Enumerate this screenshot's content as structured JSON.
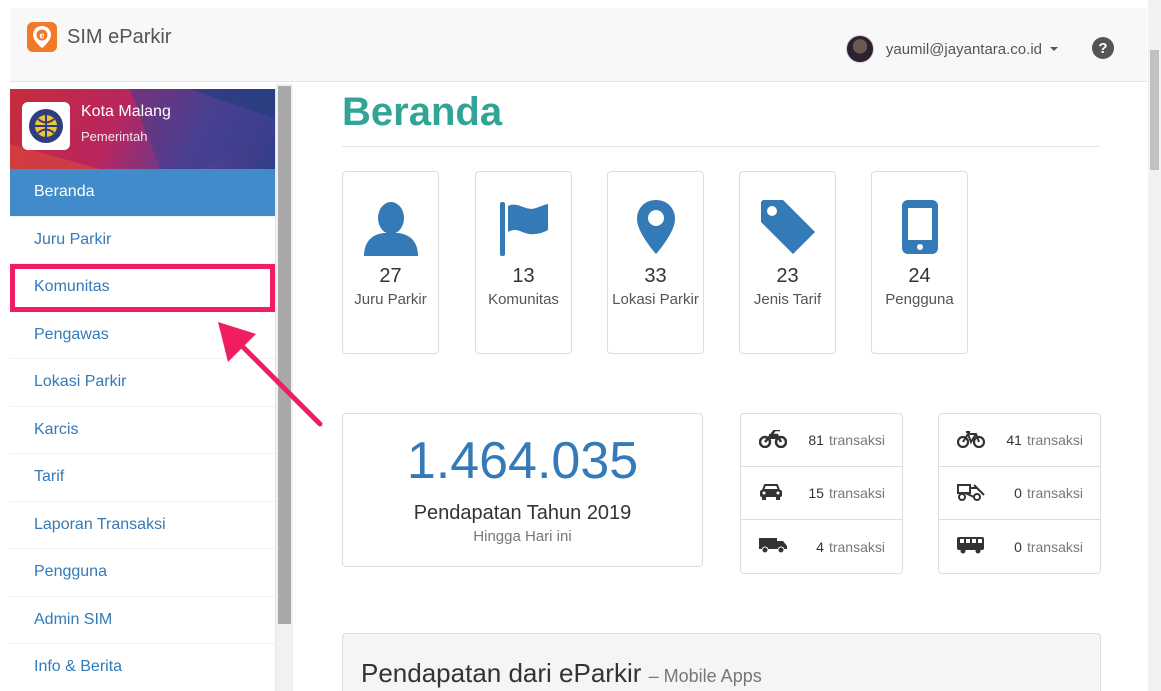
{
  "app": {
    "name": "SIM eParkir",
    "brand_color": "#f07a28"
  },
  "header": {
    "user_email": "yaumil@jayantara.co.id",
    "help_icon": "question-circle-icon"
  },
  "org": {
    "name": "Kota Malang",
    "role": "Pemerintah"
  },
  "sidebar": {
    "items": [
      {
        "label": "Beranda",
        "active": true
      },
      {
        "label": "Juru Parkir"
      },
      {
        "label": "Komunitas",
        "highlighted": true
      },
      {
        "label": "Pengawas"
      },
      {
        "label": "Lokasi Parkir"
      },
      {
        "label": "Karcis"
      },
      {
        "label": "Tarif"
      },
      {
        "label": "Laporan Transaksi"
      },
      {
        "label": "Pengguna"
      },
      {
        "label": "Admin SIM"
      },
      {
        "label": "Info & Berita"
      }
    ]
  },
  "page": {
    "title": "Beranda"
  },
  "stats": [
    {
      "icon": "user-icon",
      "value": "27",
      "label": "Juru Parkir"
    },
    {
      "icon": "flag-icon",
      "value": "13",
      "label": "Komunitas"
    },
    {
      "icon": "map-marker-icon",
      "value": "33",
      "label": "Lokasi Parkir"
    },
    {
      "icon": "tag-icon",
      "value": "23",
      "label": "Jenis Tarif"
    },
    {
      "icon": "mobile-phone-icon",
      "value": "24",
      "label": "Pengguna"
    }
  ],
  "revenue": {
    "value": "1.464.035",
    "label": "Pendapatan Tahun 2019",
    "sublabel": "Hingga Hari ini"
  },
  "transactions_left": [
    {
      "icon": "motorcycle-icon",
      "count": "81",
      "unit": "transaksi"
    },
    {
      "icon": "car-icon",
      "count": "15",
      "unit": "transaksi"
    },
    {
      "icon": "truck-icon",
      "count": "4",
      "unit": "transaksi"
    }
  ],
  "transactions_right": [
    {
      "icon": "bicycle-icon",
      "count": "41",
      "unit": "transaksi"
    },
    {
      "icon": "cart-icon",
      "count": "0",
      "unit": "transaksi"
    },
    {
      "icon": "bus-icon",
      "count": "0",
      "unit": "transaksi"
    }
  ],
  "panel": {
    "title": "Pendapatan dari eParkir",
    "subtitle": "– Mobile Apps"
  },
  "colors": {
    "accent_blue": "#337ab7",
    "active_nav": "#428bca",
    "title_green": "#31a496",
    "highlight": "#f01e61"
  }
}
